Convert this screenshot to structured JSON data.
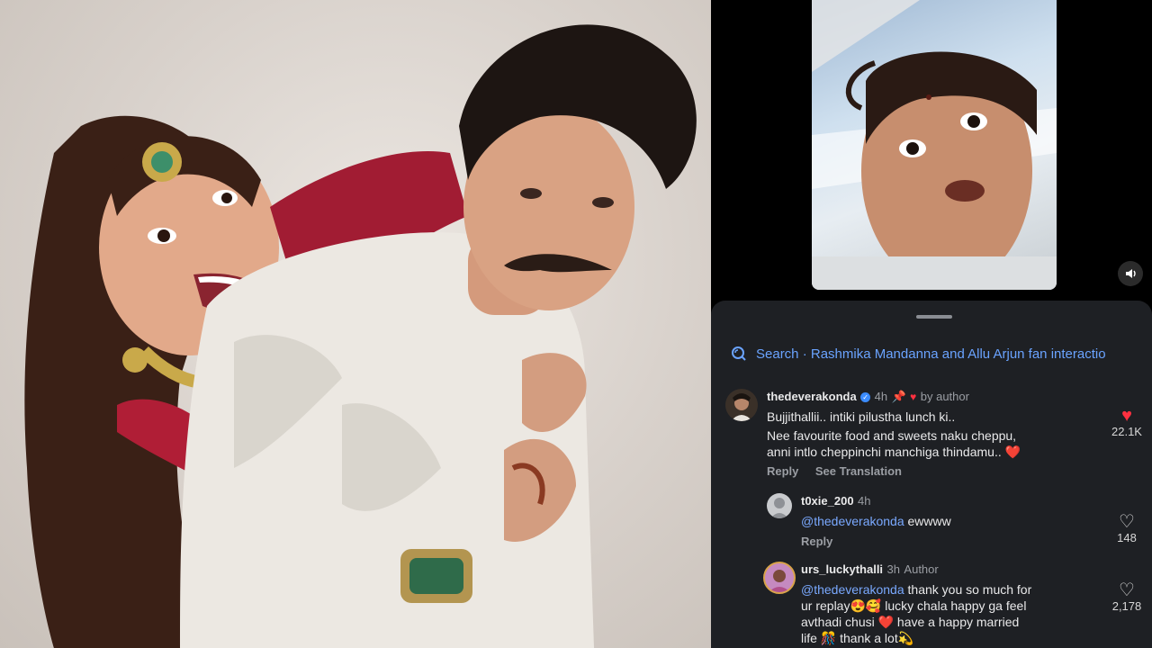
{
  "search": {
    "label": "Search · Rashmika Mandanna and Allu Arjun fan interactio"
  },
  "comments": [
    {
      "username": "thedeverakonda",
      "time": "4h",
      "by_author": "by author",
      "line1": "Bujjithallii.. intiki pilustha lunch ki..",
      "line2": "Nee favourite food and sweets naku cheppu,",
      "line3": "anni intlo cheppinchi manchiga thindamu..",
      "reply": "Reply",
      "see_translation": "See Translation",
      "likes": "22.1K"
    },
    {
      "username": "t0xie_200",
      "time": "4h",
      "mention": "@thedeverakonda",
      "text": "ewwww",
      "reply": "Reply",
      "likes": "148"
    },
    {
      "username": "urs_luckythalli",
      "time": "3h",
      "tag": "Author",
      "mention": "@thedeverakonda",
      "line1": "thank you so much for",
      "line2": "ur replay😍🥰 lucky chala  happy ga feel",
      "line3": "avthadi chusi ❤️ have a happy married",
      "line4": "life 🎊 thank a lot💫",
      "likes": "2,178"
    }
  ],
  "icons": {
    "search": "search-icon",
    "mute": "speaker-icon",
    "heart_filled": "heart-filled-icon",
    "heart_outline": "heart-outline-icon",
    "pin": "pin-icon",
    "verified": "verified-badge-icon"
  },
  "colors": {
    "link": "#6aa3ff",
    "heart": "#ff3040",
    "sheet": "#1e2024"
  }
}
